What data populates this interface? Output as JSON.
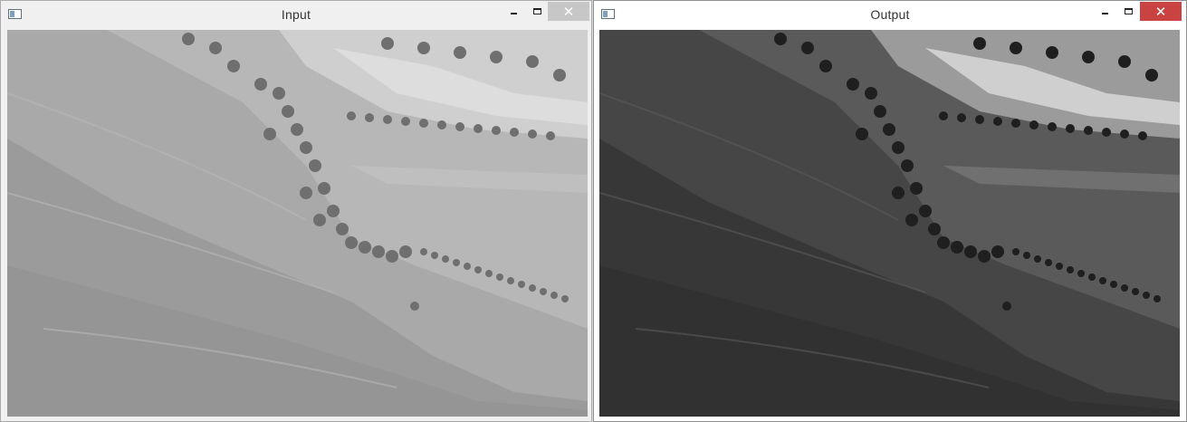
{
  "windows": {
    "input": {
      "title": "Input",
      "close_symbol": "✕",
      "icon": "app-window-icon",
      "tone": {
        "sky": "#cfcfcf",
        "hill": "#a9a9a9",
        "hill_dark": "#8f8f8f",
        "field": "#b7b7b7",
        "tree": "#6f6f6f",
        "water": "#dddddd"
      }
    },
    "output": {
      "title": "Output",
      "close_symbol": "✕",
      "icon": "app-window-icon",
      "tone": {
        "sky": "#9b9b9b",
        "hill": "#464646",
        "hill_dark": "#2b2b2b",
        "field": "#5a5a5a",
        "tree": "#1f1f1f",
        "water": "#cfcfcf"
      }
    }
  }
}
